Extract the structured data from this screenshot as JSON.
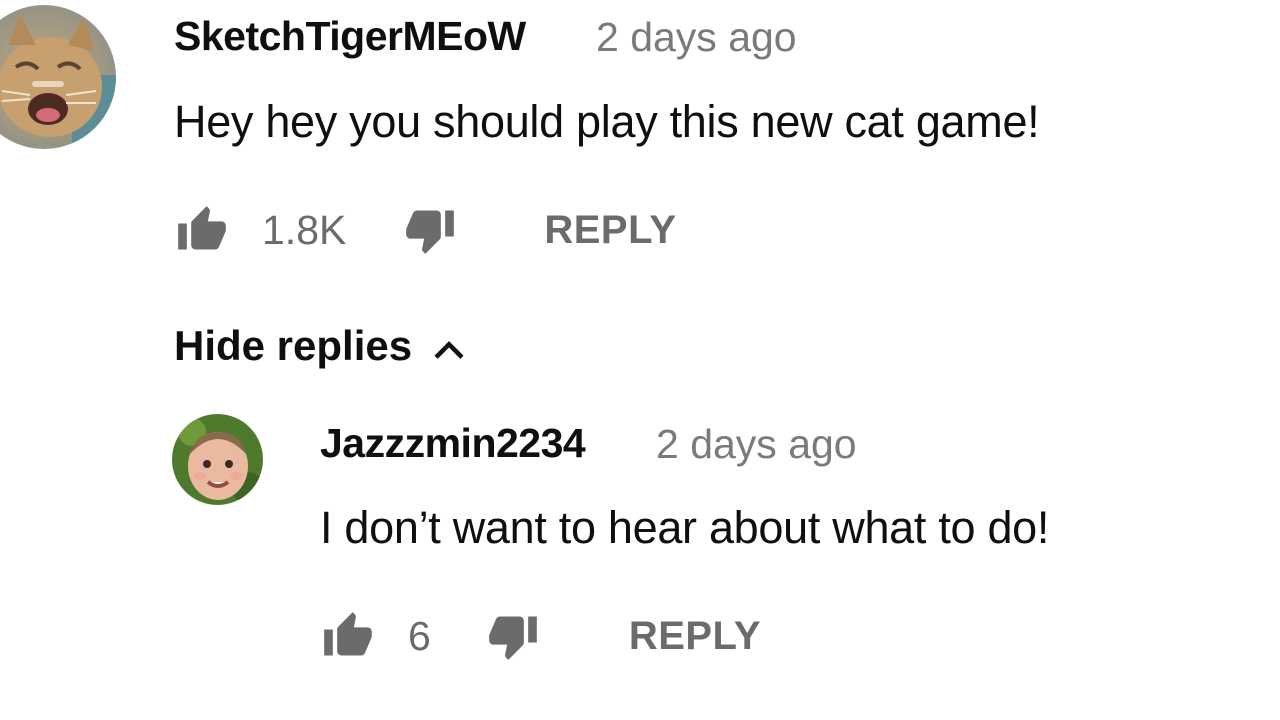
{
  "comment": {
    "author": "SketchTigerMEoW",
    "time": "2 days ago",
    "text": "Hey hey you should play this new cat game!",
    "like_count": "1.8K",
    "reply_label": "REPLY",
    "avatar_icon": "cat-avatar"
  },
  "replies_toggle": {
    "label": "Hide replies",
    "icon": "chevron-up-icon"
  },
  "reply": {
    "author": "Jazzzmin2234",
    "time": "2 days ago",
    "text": "I don’t want to hear about what to do!",
    "like_count": "6",
    "reply_label": "REPLY",
    "avatar_icon": "baby-avatar"
  },
  "colors": {
    "text_primary": "#0f0f0f",
    "text_secondary": "#6b6b6b",
    "background": "#ffffff"
  }
}
